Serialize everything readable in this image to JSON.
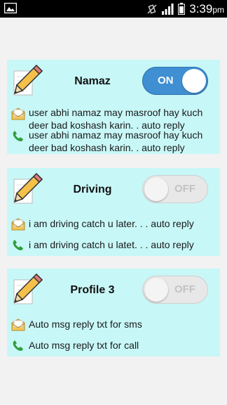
{
  "statusbar": {
    "time": "3:39",
    "ampm": "pm"
  },
  "profiles": [
    {
      "name": "Namaz",
      "toggle": "ON",
      "sms_reply": "user abhi namaz may masroof hay kuch deer bad koshash karin. . auto reply",
      "call_reply": "user abhi namaz may masroof hay kuch deer bad koshash karin. . auto reply"
    },
    {
      "name": "Driving",
      "toggle": "OFF",
      "sms_reply": "i am driving catch u later. . . auto reply",
      "call_reply": "i am driving catch u latet. . . auto reply"
    },
    {
      "name": "Profile 3",
      "toggle": "OFF",
      "sms_reply": "Auto msg reply txt for sms",
      "call_reply": "Auto msg reply txt for call"
    }
  ],
  "colors": {
    "card_bg": "#c8f7f7",
    "toggle_on": "#3f8fd2",
    "call_icon": "#2e9e3e"
  }
}
